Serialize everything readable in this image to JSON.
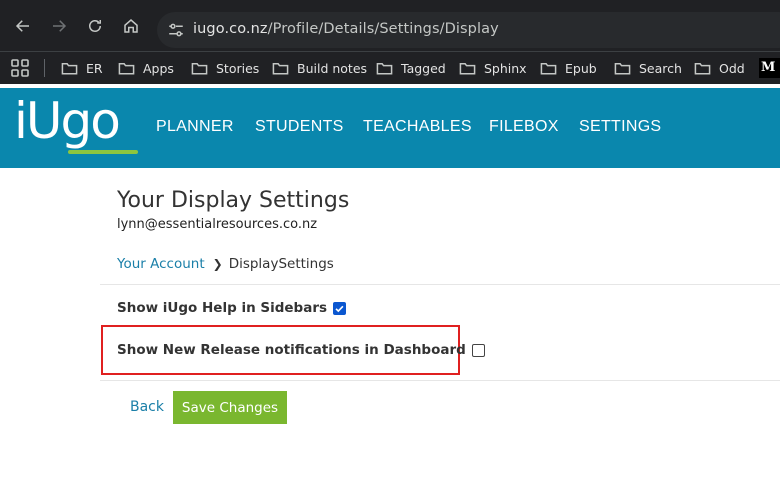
{
  "browser": {
    "url_host": "iugo.co.nz",
    "url_path": "/Profile/Details/Settings/Display",
    "bookmarks": [
      "ER",
      "Apps",
      "Stories",
      "Build notes",
      "Tagged",
      "Sphinx",
      "Epub",
      "Search",
      "Odd"
    ],
    "bookmark_overflow_label": "M"
  },
  "app": {
    "logo_text": "iUgo",
    "nav": [
      "PLANNER",
      "STUDENTS",
      "TEACHABLES",
      "FILEBOX",
      "SETTINGS"
    ],
    "colors": {
      "header": "#0a87ad",
      "accent_green": "#7ab72f",
      "link": "#1a7fa8",
      "highlight": "#e02020"
    }
  },
  "page": {
    "title": "Your Display Settings",
    "email": "lynn@essentialresources.co.nz",
    "breadcrumb": {
      "parent": "Your Account",
      "current": "DisplaySettings"
    },
    "settings": [
      {
        "label": "Show iUgo Help in Sidebars",
        "checked": true
      },
      {
        "label": "Show New Release notifications in Dashboard",
        "checked": false
      }
    ],
    "back_label": "Back",
    "save_label": "Save Changes"
  }
}
